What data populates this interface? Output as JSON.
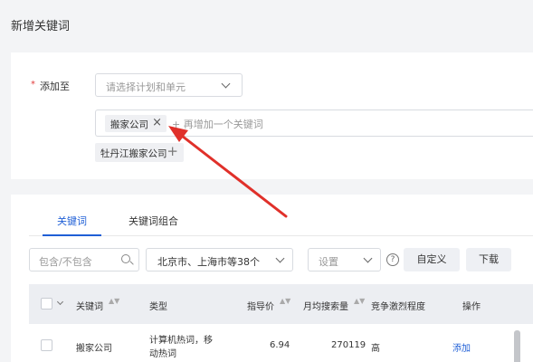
{
  "page": {
    "title": "新增关键词"
  },
  "form": {
    "required_mark": "*",
    "add_to_label": "添加至",
    "plan_select_placeholder": "请选择计划和单元",
    "keyword_tag": "搬家公司",
    "tag_close": "×",
    "add_more_placeholder": "+ 再增加一个关键词",
    "suggested_tag": "牡丹江搬家公司",
    "suggested_add": "+"
  },
  "tabs": [
    {
      "label": "关键词",
      "active": true
    },
    {
      "label": "关键词组合",
      "active": false
    }
  ],
  "toolbar": {
    "filter_placeholder": "包含/不包含",
    "region_value": "北京市、上海市等38个",
    "setting_placeholder": "设置",
    "help_symbol": "?",
    "custom_label": "自定义",
    "download_label": "下载"
  },
  "table": {
    "headers": {
      "keyword": "关键词",
      "type": "类型",
      "guide_price": "指导价",
      "monthly_search": "月均搜索量",
      "competition": "竞争激烈程度",
      "action": "操作"
    },
    "sort_symbol": "▲▼",
    "rows": [
      {
        "keyword": "搬家公司",
        "type_line1": "计算机热词，移",
        "type_line2": "动热词",
        "guide_price": "6.94",
        "monthly_search": "270119",
        "competition": "高",
        "action": "添加"
      }
    ]
  },
  "colors": {
    "accent": "#1f5fd6",
    "arrow": "#e0302a",
    "required": "#e23d3d"
  }
}
